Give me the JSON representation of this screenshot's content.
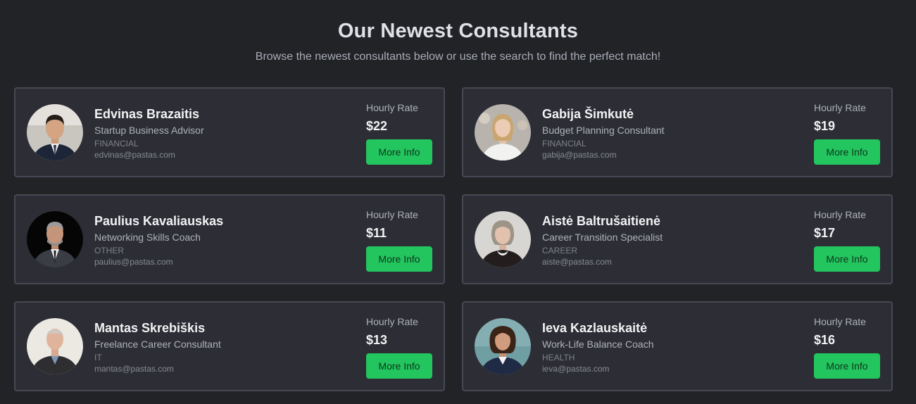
{
  "header": {
    "title": "Our Newest Consultants",
    "subtitle": "Browse the newest consultants below or use the search to find the perfect match!"
  },
  "colors": {
    "background": "#222327",
    "card": "#2d2e35",
    "card_border": "#464953",
    "accent_button": "#22c55e"
  },
  "consultants": [
    {
      "name": "Edvinas Brazaitis",
      "role": "Startup Business Advisor",
      "category": "FINANCIAL",
      "email": "edvinas@pastas.com",
      "rate_label": "Hourly Rate",
      "rate": "$22",
      "button": "More Info",
      "avatar_icon": "man-suit-photo"
    },
    {
      "name": "Gabija Šimkutė",
      "role": "Budget Planning Consultant",
      "category": "FINANCIAL",
      "email": "gabija@pastas.com",
      "rate_label": "Hourly Rate",
      "rate": "$19",
      "button": "More Info",
      "avatar_icon": "woman-blonde-photo"
    },
    {
      "name": "Paulius Kavaliauskas",
      "role": "Networking Skills Coach",
      "category": "OTHER",
      "email": "paulius@pastas.com",
      "rate_label": "Hourly Rate",
      "rate": "$11",
      "button": "More Info",
      "avatar_icon": "man-grey-suit-photo"
    },
    {
      "name": "Aistė Baltrušaitienė",
      "role": "Career Transition Specialist",
      "category": "CAREER",
      "email": "aiste@pastas.com",
      "rate_label": "Hourly Rate",
      "rate": "$17",
      "button": "More Info",
      "avatar_icon": "woman-grey-hair-photo"
    },
    {
      "name": "Mantas Skrebiškis",
      "role": "Freelance Career Consultant",
      "category": "IT",
      "email": "mantas@pastas.com",
      "rate_label": "Hourly Rate",
      "rate": "$13",
      "button": "More Info",
      "avatar_icon": "man-bald-photo"
    },
    {
      "name": "Ieva Kazlauskaitė",
      "role": "Work-Life Balance Coach",
      "category": "HEALTH",
      "email": "ieva@pastas.com",
      "rate_label": "Hourly Rate",
      "rate": "$16",
      "button": "More Info",
      "avatar_icon": "woman-curly-hair-photo"
    }
  ]
}
